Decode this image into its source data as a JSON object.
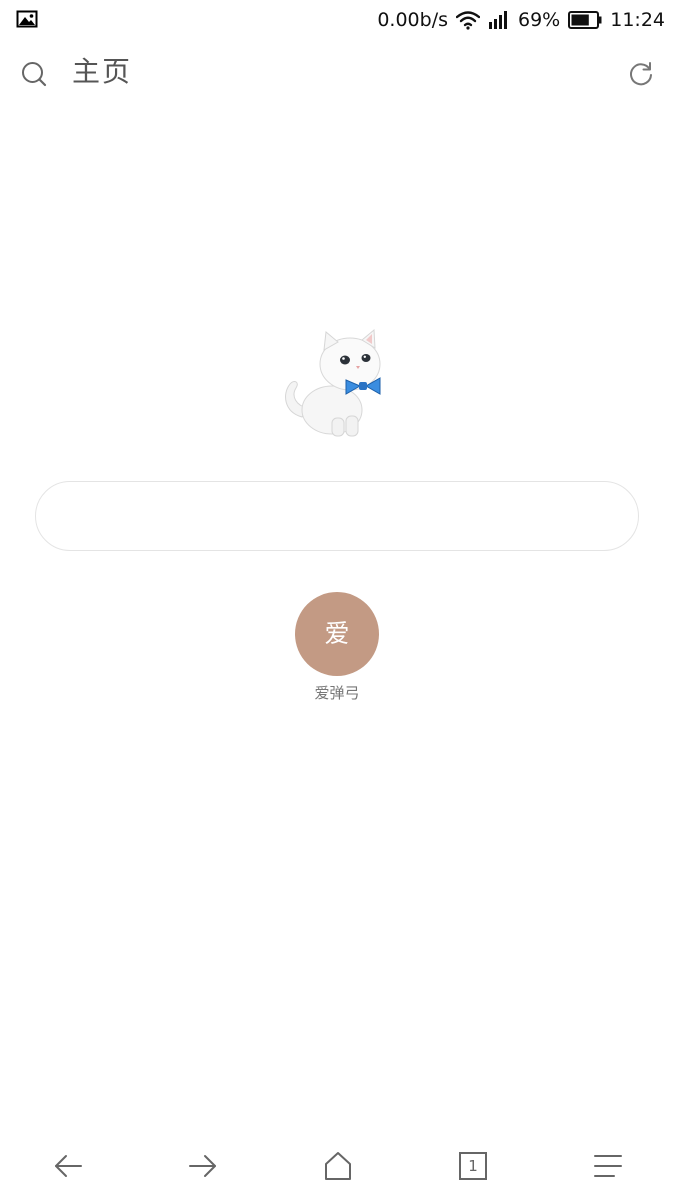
{
  "status_bar": {
    "network_speed": "0.00b/s",
    "battery_percent": "69%",
    "time": "11:24",
    "battery_level": 0.69,
    "icons": [
      "image-notification-icon",
      "wifi-icon",
      "signal-icon",
      "battery-icon"
    ]
  },
  "header": {
    "title": "主页",
    "icons": [
      "search-icon",
      "refresh-icon"
    ]
  },
  "search": {
    "value": "",
    "placeholder": ""
  },
  "shortcuts": [
    {
      "glyph": "爱",
      "label": "爱弹弓",
      "color": "#c39a84"
    }
  ],
  "bottom_nav": {
    "tab_count": "1",
    "icons": [
      "back-arrow-icon",
      "forward-arrow-icon",
      "home-icon",
      "tabs-icon",
      "menu-icon"
    ]
  }
}
